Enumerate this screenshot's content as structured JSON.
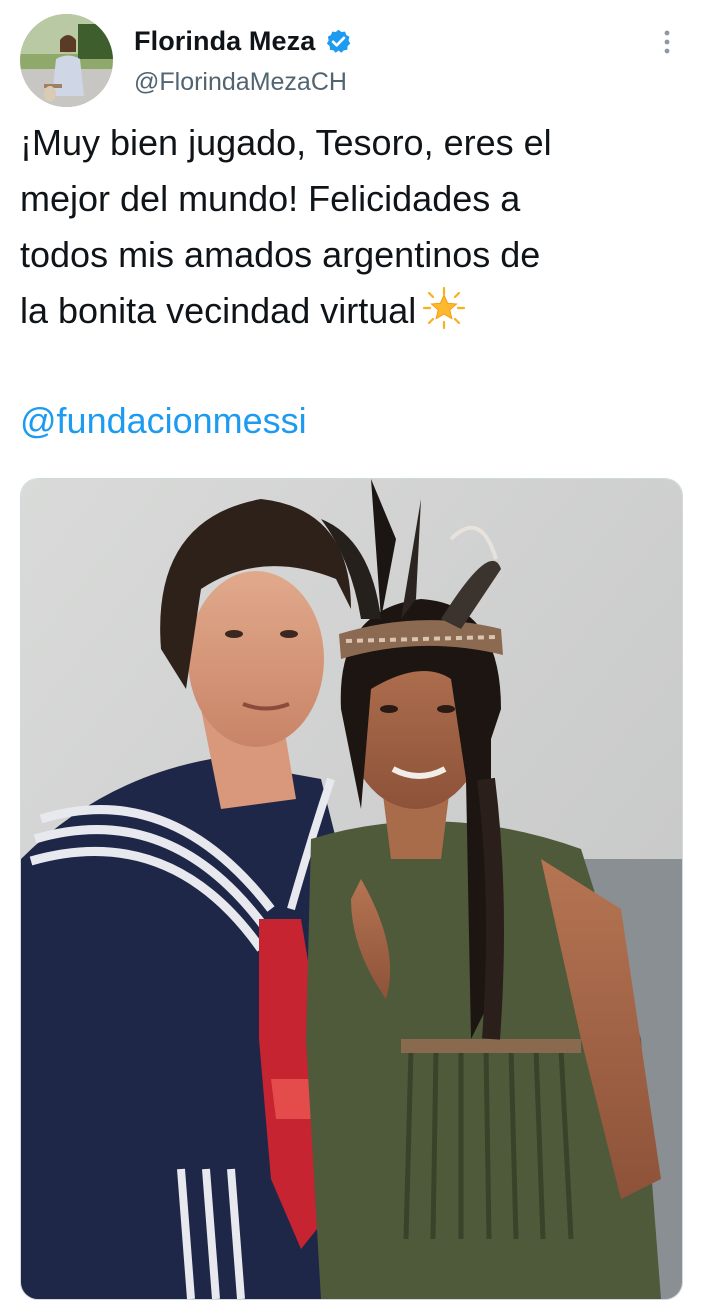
{
  "author": {
    "display_name": "Florinda Meza",
    "handle": "@FlorindaMezaCH",
    "verified": true,
    "avatar_icon": "profile-photo"
  },
  "tweet": {
    "lines": [
      "¡Muy bien jugado, Tesoro, eres el",
      "mejor del mundo! Felicidades a",
      "todos mis amados argentinos de",
      "la bonita vecindad virtual"
    ],
    "emoji": "sparkle-star-emoji",
    "mention": "@fundacionmessi"
  },
  "media": {
    "type": "photo",
    "content": "couple-costume-photo"
  },
  "colors": {
    "text": "#0f1419",
    "secondary": "#536471",
    "link": "#1d9bf0",
    "verified": "#1d9bf0"
  },
  "icons": {
    "more": "more-options-icon",
    "verified": "verified-badge-icon"
  }
}
